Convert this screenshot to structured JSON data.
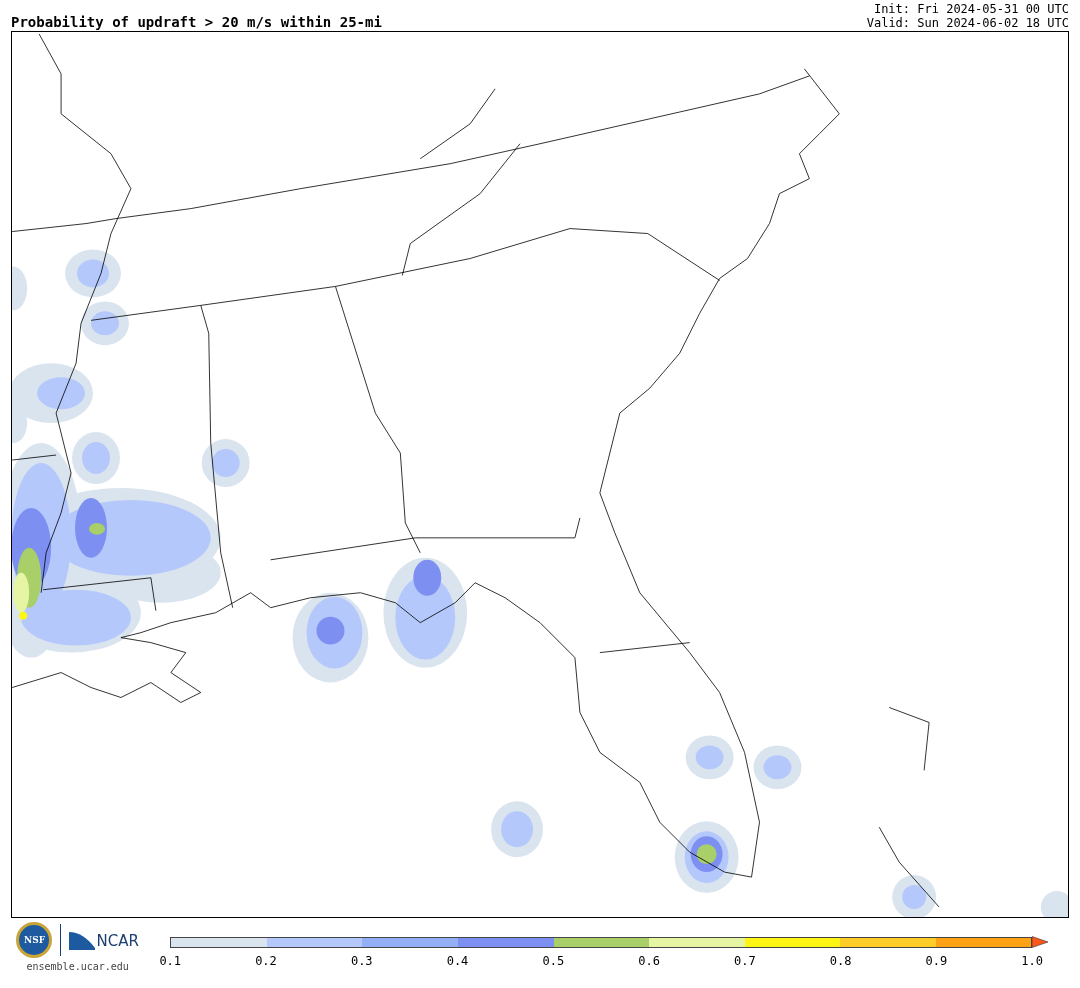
{
  "title": "Probability of updraft > 20 m/s within 25-mi",
  "init": "Init: Fri 2024-05-31 00 UTC",
  "valid": "Valid: Sun 2024-06-02 18 UTC",
  "logos": {
    "nsf": "NSF",
    "ncar": "NCAR"
  },
  "site": "ensemble.ucar.edu",
  "legend": {
    "bins": [
      {
        "color": "#dae4ef"
      },
      {
        "color": "#b4c8fb"
      },
      {
        "color": "#93b0f7"
      },
      {
        "color": "#7d90f2"
      },
      {
        "color": "#a8cf68"
      },
      {
        "color": "#e6f5a4"
      },
      {
        "color": "#fdf614"
      },
      {
        "color": "#fecd28"
      },
      {
        "color": "#fda214"
      }
    ],
    "extend_arrow": {
      "color": "#f9561a"
    },
    "ticks": [
      "0.1",
      "0.2",
      "0.3",
      "0.4",
      "0.5",
      "0.6",
      "0.7",
      "0.8",
      "0.9",
      "1.0"
    ]
  }
}
